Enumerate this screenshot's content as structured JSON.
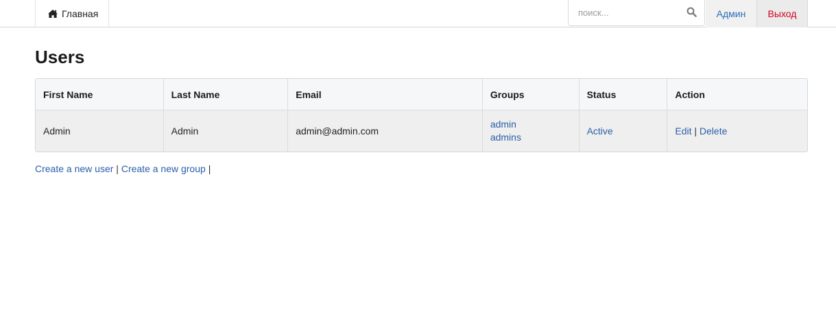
{
  "navbar": {
    "home_label": "Главная",
    "search_placeholder": "поиск...",
    "admin_label": "Админ",
    "logout_label": "Выход",
    "colors": {
      "link": "#2a6db5",
      "logout": "#d0021b"
    }
  },
  "page": {
    "title": "Users"
  },
  "table": {
    "headers": [
      "First Name",
      "Last Name",
      "Email",
      "Groups",
      "Status",
      "Action"
    ],
    "rows": [
      {
        "first_name": "Admin",
        "last_name": "Admin",
        "email": "admin@admin.com",
        "groups": [
          "admin",
          "admins"
        ],
        "status": "Active",
        "edit_label": "Edit",
        "action_separator": "|",
        "delete_label": "Delete"
      }
    ]
  },
  "footer": {
    "create_user_label": "Create a new user",
    "create_group_label": "Create a new group",
    "separator": "|"
  },
  "icons": {
    "home": "home-icon",
    "search": "search-icon"
  }
}
